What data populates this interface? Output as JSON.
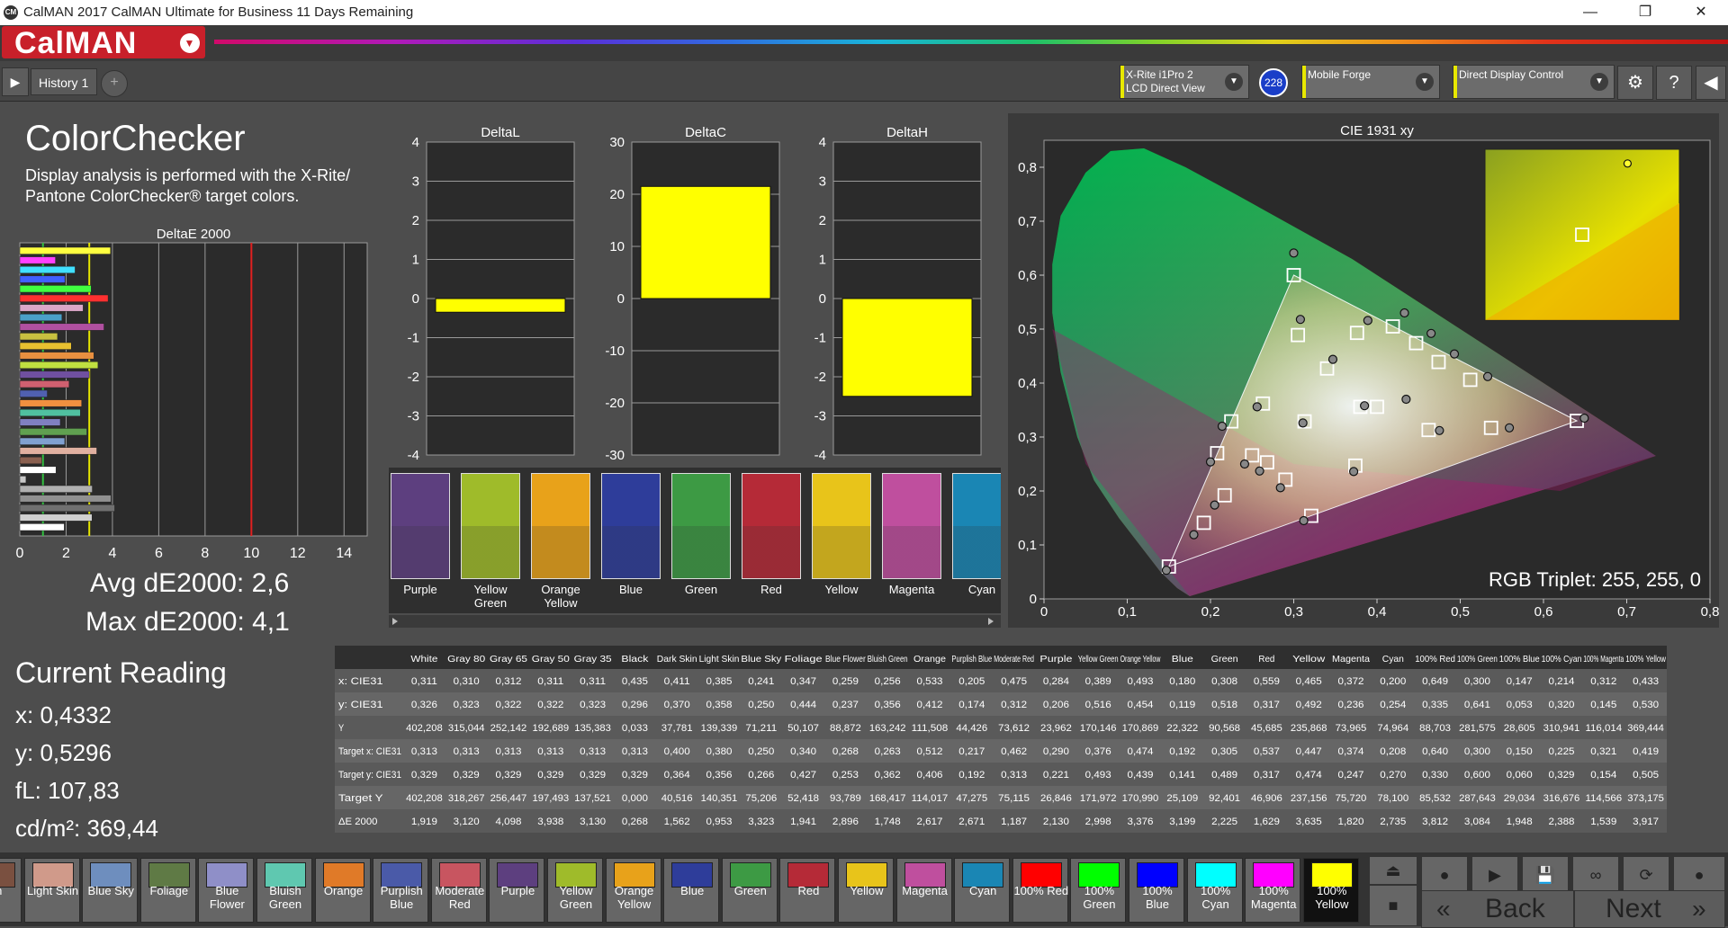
{
  "window": {
    "title": "CalMAN 2017 CalMAN Ultimate for Business 11 Days Remaining",
    "app_icon": "CM",
    "minimize": "—",
    "restore": "❐",
    "close": "✕"
  },
  "logo": {
    "text": "CalMAN",
    "drop": "▼"
  },
  "toolbar": {
    "play": "▶",
    "history_tab": "History 1",
    "add": "+",
    "devices": [
      {
        "line1": "X-Rite i1Pro 2",
        "line2": "LCD Direct View"
      },
      {
        "line1": "Mobile Forge",
        "line2": ""
      },
      {
        "line1": "Direct Display Control",
        "line2": ""
      }
    ],
    "badge": "228",
    "settings": "⚙",
    "help": "?",
    "collapse": "◀",
    "chevron": "▼"
  },
  "colorchecker": {
    "title": "ColorChecker",
    "description_line1": "Display analysis is performed with the X-Rite/",
    "description_line2": "Pantone ColorChecker® target colors."
  },
  "chart_data": [
    {
      "type": "bar",
      "title": "DeltaE 2000",
      "orientation": "horizontal",
      "xlim": [
        0,
        15
      ],
      "xticks": [
        "0",
        "2",
        "4",
        "6",
        "8",
        "10",
        "12",
        "14"
      ],
      "reference_lines": [
        1,
        3,
        10
      ],
      "series": [
        {
          "values": [
            3.917,
            1.539,
            2.388,
            1.948,
            3.084,
            3.812,
            2.735,
            1.82,
            3.635,
            1.629,
            2.225,
            3.199,
            3.376,
            2.998,
            2.13,
            1.187,
            2.671,
            2.617,
            1.748,
            2.896,
            1.941,
            3.323,
            0.953,
            1.562,
            0.268,
            3.13,
            3.938,
            4.098,
            3.12,
            1.919
          ]
        }
      ]
    },
    {
      "type": "bar",
      "title": "DeltaL",
      "ylim": [
        -4,
        4
      ],
      "yticks": [
        "4",
        "3",
        "2",
        "1",
        "0",
        "-1",
        "-2",
        "-3",
        "-4"
      ],
      "values": [
        -0.35
      ]
    },
    {
      "type": "bar",
      "title": "DeltaC",
      "ylim": [
        -30,
        30
      ],
      "yticks": [
        "30",
        "20",
        "10",
        "0",
        "-10",
        "-20",
        "-30"
      ],
      "values": [
        21.5
      ]
    },
    {
      "type": "bar",
      "title": "DeltaH",
      "ylim": [
        -4,
        4
      ],
      "yticks": [
        "4",
        "3",
        "2",
        "1",
        "0",
        "-1",
        "-2",
        "-3",
        "-4"
      ],
      "values": [
        -2.5
      ]
    },
    {
      "type": "scatter",
      "title": "CIE 1931 xy",
      "xlim": [
        0,
        0.8
      ],
      "ylim": [
        0,
        0.85
      ],
      "xticks": [
        "0",
        "0,1",
        "0,2",
        "0,3",
        "0,4",
        "0,5",
        "0,6",
        "0,7",
        "0,8"
      ],
      "yticks": [
        "0",
        "0,1",
        "0,2",
        "0,3",
        "0,4",
        "0,5",
        "0,6",
        "0,7",
        "0,8"
      ],
      "target_gamut": [
        [
          0.64,
          0.33
        ],
        [
          0.3,
          0.6
        ],
        [
          0.15,
          0.06
        ]
      ],
      "measured": [
        [
          0.649,
          0.335
        ],
        [
          0.3,
          0.641
        ],
        [
          0.147,
          0.053
        ],
        [
          0.214,
          0.32
        ],
        [
          0.312,
          0.145
        ],
        [
          0.433,
          0.53
        ],
        [
          0.311,
          0.326
        ],
        [
          0.18,
          0.119
        ],
        [
          0.308,
          0.518
        ],
        [
          0.559,
          0.317
        ],
        [
          0.465,
          0.492
        ],
        [
          0.372,
          0.236
        ],
        [
          0.2,
          0.254
        ],
        [
          0.435,
          0.37
        ],
        [
          0.385,
          0.358
        ],
        [
          0.241,
          0.25
        ],
        [
          0.347,
          0.444
        ],
        [
          0.259,
          0.237
        ],
        [
          0.256,
          0.356
        ],
        [
          0.533,
          0.412
        ],
        [
          0.205,
          0.174
        ],
        [
          0.475,
          0.312
        ],
        [
          0.284,
          0.206
        ],
        [
          0.389,
          0.516
        ],
        [
          0.493,
          0.454
        ]
      ],
      "targets": [
        [
          0.64,
          0.33
        ],
        [
          0.3,
          0.6
        ],
        [
          0.15,
          0.06
        ],
        [
          0.225,
          0.329
        ],
        [
          0.321,
          0.154
        ],
        [
          0.419,
          0.505
        ],
        [
          0.313,
          0.329
        ],
        [
          0.192,
          0.141
        ],
        [
          0.305,
          0.489
        ],
        [
          0.537,
          0.317
        ],
        [
          0.447,
          0.474
        ],
        [
          0.374,
          0.247
        ],
        [
          0.208,
          0.27
        ],
        [
          0.4,
          0.356
        ],
        [
          0.38,
          0.356
        ],
        [
          0.25,
          0.266
        ],
        [
          0.34,
          0.427
        ],
        [
          0.268,
          0.253
        ],
        [
          0.263,
          0.362
        ],
        [
          0.512,
          0.406
        ],
        [
          0.217,
          0.192
        ],
        [
          0.462,
          0.313
        ],
        [
          0.29,
          0.221
        ],
        [
          0.376,
          0.493
        ],
        [
          0.474,
          0.439
        ]
      ],
      "inset_measured": [
        0.433,
        0.53
      ],
      "inset_target": [
        0.419,
        0.505
      ]
    }
  ],
  "cie": {
    "rgb_triplet": "RGB Triplet: 255, 255, 0"
  },
  "stats": {
    "avg": "Avg dE2000: 2,6",
    "max": "Max dE2000: 4,1"
  },
  "current_reading": {
    "title": "Current Reading",
    "x": "x: 0,4332",
    "y": "y: 0,5296",
    "fl": "fL: 107,83",
    "cdm2": "cd/m²: 369,44"
  },
  "swatches": [
    {
      "label": "Purple",
      "color": "#5d3f7f"
    },
    {
      "label": "Yellow Green",
      "color": "#9fbb2a"
    },
    {
      "label": "Orange Yellow",
      "color": "#e8a21a"
    },
    {
      "label": "Blue",
      "color": "#2e3d9a"
    },
    {
      "label": "Green",
      "color": "#3d9a44"
    },
    {
      "label": "Red",
      "color": "#b52a37"
    },
    {
      "label": "Yellow",
      "color": "#e8c41a"
    },
    {
      "label": "Magenta",
      "color": "#bf4f9e"
    },
    {
      "label": "Cyan",
      "color": "#1a86b4"
    }
  ],
  "table": {
    "headers": [
      "",
      "White",
      "Gray 80",
      "Gray 65",
      "Gray 50",
      "Gray 35",
      "Black",
      "Dark Skin",
      "Light Skin",
      "Blue Sky",
      "Foliage",
      "Blue Flower",
      "Bluish Green",
      "Orange",
      "Purplish Blue",
      "Moderate Red",
      "Purple",
      "Yellow Green",
      "Orange Yellow",
      "Blue",
      "Green",
      "Red",
      "Yellow",
      "Magenta",
      "Cyan",
      "100% Red",
      "100% Green",
      "100% Blue",
      "100% Cyan",
      "100% Magenta",
      "100% Yellow"
    ],
    "rows": [
      [
        "x: CIE31",
        "0,311",
        "0,310",
        "0,312",
        "0,311",
        "0,311",
        "0,435",
        "0,411",
        "0,385",
        "0,241",
        "0,347",
        "0,259",
        "0,256",
        "0,533",
        "0,205",
        "0,475",
        "0,284",
        "0,389",
        "0,493",
        "0,180",
        "0,308",
        "0,559",
        "0,465",
        "0,372",
        "0,200",
        "0,649",
        "0,300",
        "0,147",
        "0,214",
        "0,312",
        "0,433"
      ],
      [
        "y: CIE31",
        "0,326",
        "0,323",
        "0,322",
        "0,322",
        "0,323",
        "0,296",
        "0,370",
        "0,358",
        "0,250",
        "0,444",
        "0,237",
        "0,356",
        "0,412",
        "0,174",
        "0,312",
        "0,206",
        "0,516",
        "0,454",
        "0,119",
        "0,518",
        "0,317",
        "0,492",
        "0,236",
        "0,254",
        "0,335",
        "0,641",
        "0,053",
        "0,320",
        "0,145",
        "0,530"
      ],
      [
        "Y",
        "402,208",
        "315,044",
        "252,142",
        "192,689",
        "135,383",
        "0,033",
        "37,781",
        "139,339",
        "71,211",
        "50,107",
        "88,872",
        "163,242",
        "111,508",
        "44,426",
        "73,612",
        "23,962",
        "170,146",
        "170,869",
        "22,322",
        "90,568",
        "45,685",
        "235,868",
        "73,965",
        "74,964",
        "88,703",
        "281,575",
        "28,605",
        "310,941",
        "116,014",
        "369,444"
      ],
      [
        "Target x: CIE31",
        "0,313",
        "0,313",
        "0,313",
        "0,313",
        "0,313",
        "0,313",
        "0,400",
        "0,380",
        "0,250",
        "0,340",
        "0,268",
        "0,263",
        "0,512",
        "0,217",
        "0,462",
        "0,290",
        "0,376",
        "0,474",
        "0,192",
        "0,305",
        "0,537",
        "0,447",
        "0,374",
        "0,208",
        "0,640",
        "0,300",
        "0,150",
        "0,225",
        "0,321",
        "0,419"
      ],
      [
        "Target y: CIE31",
        "0,329",
        "0,329",
        "0,329",
        "0,329",
        "0,329",
        "0,329",
        "0,364",
        "0,356",
        "0,266",
        "0,427",
        "0,253",
        "0,362",
        "0,406",
        "0,192",
        "0,313",
        "0,221",
        "0,493",
        "0,439",
        "0,141",
        "0,489",
        "0,317",
        "0,474",
        "0,247",
        "0,270",
        "0,330",
        "0,600",
        "0,060",
        "0,329",
        "0,154",
        "0,505"
      ],
      [
        "Target Y",
        "402,208",
        "318,267",
        "256,447",
        "197,493",
        "137,521",
        "0,000",
        "40,516",
        "140,351",
        "75,206",
        "52,418",
        "93,789",
        "168,417",
        "114,017",
        "47,275",
        "75,115",
        "26,846",
        "171,972",
        "170,990",
        "25,109",
        "92,401",
        "46,906",
        "237,156",
        "75,720",
        "78,100",
        "85,532",
        "287,643",
        "29,034",
        "316,676",
        "114,566",
        "373,175"
      ],
      [
        "ΔE 2000",
        "1,919",
        "3,120",
        "4,098",
        "3,938",
        "3,130",
        "0,268",
        "1,562",
        "0,953",
        "3,323",
        "1,941",
        "2,896",
        "1,748",
        "2,617",
        "2,671",
        "1,187",
        "2,130",
        "2,998",
        "3,376",
        "3,199",
        "2,225",
        "1,629",
        "3,635",
        "1,820",
        "2,735",
        "3,812",
        "3,084",
        "1,948",
        "2,388",
        "1,539",
        "3,917"
      ]
    ]
  },
  "bottom_swatches": [
    {
      "label": "kin",
      "color": "#7a5040"
    },
    {
      "label": "Light Skin",
      "color": "#d09a8a"
    },
    {
      "label": "Blue Sky",
      "color": "#6e8ebe"
    },
    {
      "label": "Foliage",
      "color": "#5f7a45"
    },
    {
      "label": "Blue Flower",
      "color": "#8f8fc8"
    },
    {
      "label": "Bluish Green",
      "color": "#5fc8b0"
    },
    {
      "label": "Orange",
      "color": "#e07a28"
    },
    {
      "label": "Purplish Blue",
      "color": "#4a5aa8"
    },
    {
      "label": "Moderate Red",
      "color": "#c85560"
    },
    {
      "label": "Purple",
      "color": "#5d3f7f"
    },
    {
      "label": "Yellow Green",
      "color": "#9fbb2a"
    },
    {
      "label": "Orange Yellow",
      "color": "#e8a21a"
    },
    {
      "label": "Blue",
      "color": "#2e3d9a"
    },
    {
      "label": "Green",
      "color": "#3d9a44"
    },
    {
      "label": "Red",
      "color": "#b52a37"
    },
    {
      "label": "Yellow",
      "color": "#e8c41a"
    },
    {
      "label": "Magenta",
      "color": "#bf4f9e"
    },
    {
      "label": "Cyan",
      "color": "#1a86b4"
    },
    {
      "label": "100% Red",
      "color": "#ff0000"
    },
    {
      "label": "100% Green",
      "color": "#00ff00"
    },
    {
      "label": "100% Blue",
      "color": "#0000ff"
    },
    {
      "label": "100% Cyan",
      "color": "#00ffff"
    },
    {
      "label": "100% Magenta",
      "color": "#ff00ff"
    },
    {
      "label": "100% Yellow",
      "color": "#ffff00",
      "selected": true
    }
  ],
  "controls": {
    "back": "Back",
    "next": "Next",
    "back_arrows": "«",
    "next_arrows": "»",
    "eject": "⏏",
    "stop": "■",
    "record": "●",
    "play": "▶",
    "save": "💾",
    "loop": "∞",
    "refresh": "⟳"
  }
}
